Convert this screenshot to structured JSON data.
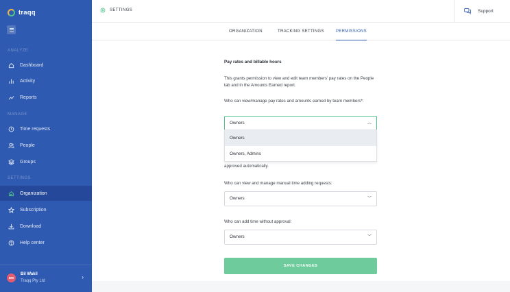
{
  "app": {
    "name": "traqq"
  },
  "sidebar": {
    "sections": {
      "analyze": "ANALYZE",
      "manage": "MANAGE",
      "settings": "SETTINGS"
    },
    "items": [
      {
        "label": "Dashboard",
        "icon": "home-icon"
      },
      {
        "label": "Activity",
        "icon": "bar-chart-icon"
      },
      {
        "label": "Reports",
        "icon": "trend-icon"
      },
      {
        "label": "Time requests",
        "icon": "clock-icon"
      },
      {
        "label": "People",
        "icon": "users-icon"
      },
      {
        "label": "Groups",
        "icon": "layers-icon"
      },
      {
        "label": "Organization",
        "icon": "building-icon",
        "active": true
      },
      {
        "label": "Subscription",
        "icon": "star-icon"
      },
      {
        "label": "Download",
        "icon": "download-icon"
      },
      {
        "label": "Help center",
        "icon": "help-icon"
      }
    ],
    "user": {
      "initials": "BW",
      "name": "Bil Wakil",
      "company": "Traqq Pty Ltd"
    }
  },
  "topbar": {
    "breadcrumb": "SETTINGS",
    "support_label": "Support"
  },
  "tabs": [
    {
      "label": "ORGANIZATION",
      "active": false
    },
    {
      "label": "TRACKING SETTINGS",
      "active": false
    },
    {
      "label": "PERMISSIONS",
      "active": true
    }
  ],
  "form": {
    "title": "Pay rates and billable hours",
    "description": "This grants permission to view and edit team members' pay rates on the People tab and in the Amounts Earned report.",
    "q1": "Who can view/manage pay rates and amounts earned by team members*:",
    "q1_value": "Owners",
    "dropdown_options": [
      "Owners",
      "Owners, Admins"
    ],
    "partial_text": "approved automatically.",
    "q2": "Who can view and manage manual time adding requests:",
    "q2_value": "Owners",
    "q3": "Who can add time without approval:",
    "q3_value": "Owners",
    "save_label": "SAVE CHANGES"
  },
  "colors": {
    "sidebar": "#2f5ab1",
    "active_item": "#25489a",
    "accent_green": "#4fc38b",
    "save_button": "#6dcb9c"
  }
}
